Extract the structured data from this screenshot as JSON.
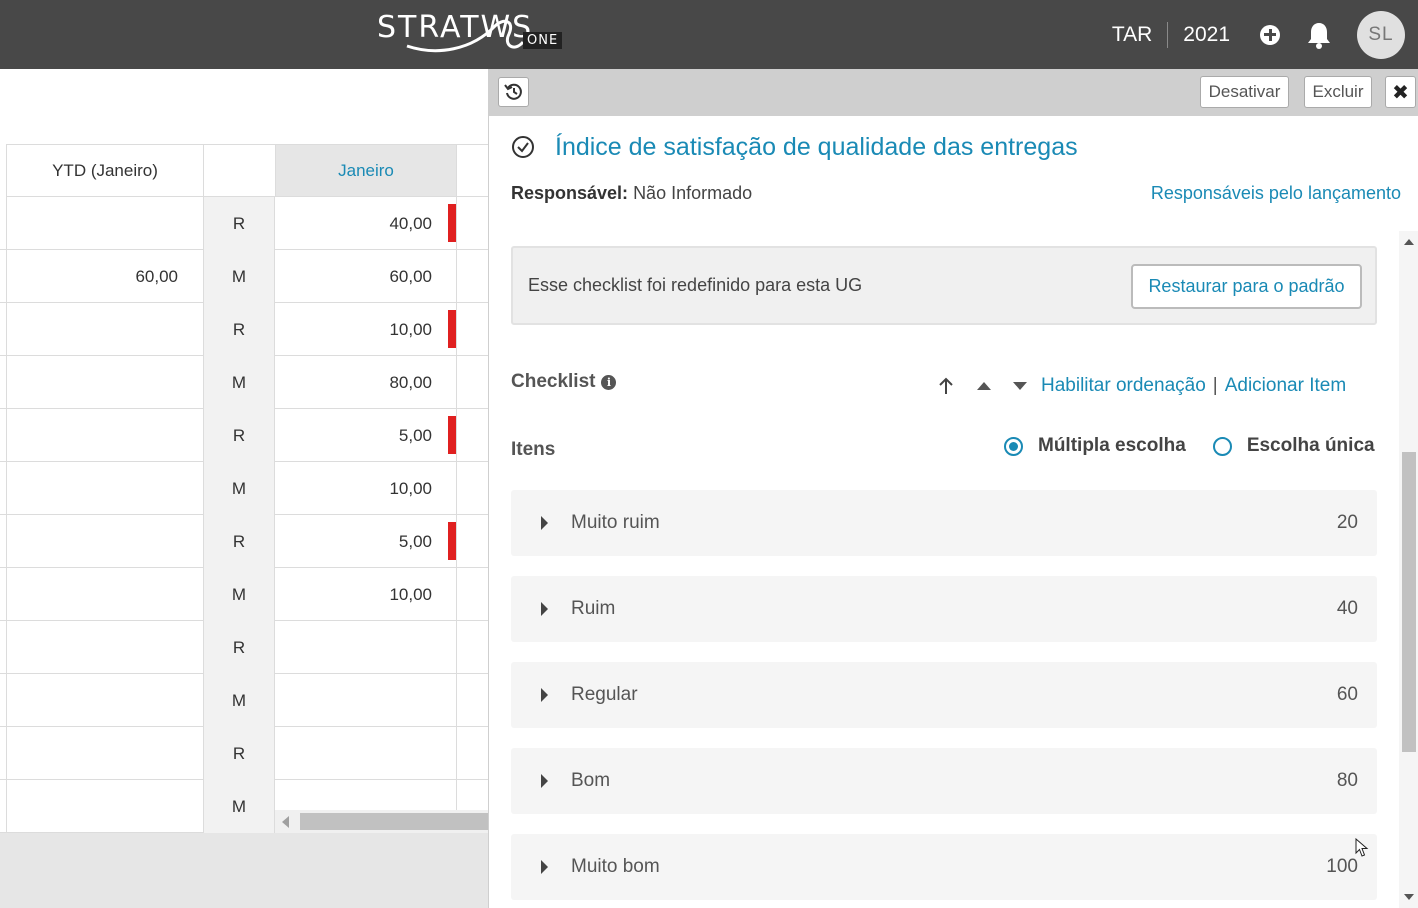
{
  "topbar": {
    "logo_text": "STRATWS",
    "logo_suffix": "ONE",
    "org": "TAR",
    "year": "2021",
    "avatar_initials": "SL",
    "icons": {
      "add": "plus-circle-icon",
      "notifications": "bell-icon"
    }
  },
  "table": {
    "headers": {
      "ytd": "YTD (Janeiro)",
      "type": "",
      "month": "Janeiro"
    },
    "rows": [
      {
        "ytd": "",
        "type": "R",
        "jan": "40,00",
        "flag": true
      },
      {
        "ytd": "60,00",
        "type": "M",
        "jan": "60,00",
        "flag": false
      },
      {
        "ytd": "",
        "type": "R",
        "jan": "10,00",
        "flag": true
      },
      {
        "ytd": "",
        "type": "M",
        "jan": "80,00",
        "flag": false
      },
      {
        "ytd": "",
        "type": "R",
        "jan": "5,00",
        "flag": true
      },
      {
        "ytd": "",
        "type": "M",
        "jan": "10,00",
        "flag": false
      },
      {
        "ytd": "",
        "type": "R",
        "jan": "5,00",
        "flag": true
      },
      {
        "ytd": "",
        "type": "M",
        "jan": "10,00",
        "flag": false
      },
      {
        "ytd": "",
        "type": "R",
        "jan": "",
        "flag": false
      },
      {
        "ytd": "",
        "type": "M",
        "jan": "",
        "flag": false
      },
      {
        "ytd": "",
        "type": "R",
        "jan": "",
        "flag": false
      },
      {
        "ytd": "",
        "type": "M",
        "jan": "",
        "flag": false
      }
    ]
  },
  "panel": {
    "toolbar": {
      "history_icon": "history-icon",
      "deactivate": "Desativar",
      "delete": "Excluir",
      "close": "✖"
    },
    "title": "Índice de satisfação de qualidade das entregas",
    "responsible_label": "Responsável:",
    "responsible_value": "Não Informado",
    "responsible_link": "Responsáveis pelo lançamento",
    "notice": {
      "text": "Esse checklist foi redefinido para esta UG",
      "button": "Restaurar para o padrão"
    },
    "checklist_label": "Checklist",
    "enable_sorting": "Habilitar ordenação",
    "add_item": "Adicionar Item",
    "items_label": "Itens",
    "choice": {
      "multiple": "Múltipla escolha",
      "single": "Escolha única",
      "selected": "multiple"
    },
    "items": [
      {
        "label": "Muito ruim",
        "score": "20"
      },
      {
        "label": "Ruim",
        "score": "40"
      },
      {
        "label": "Regular",
        "score": "60"
      },
      {
        "label": "Bom",
        "score": "80"
      },
      {
        "label": "Muito bom",
        "score": "100"
      }
    ]
  },
  "colors": {
    "accent": "#1a8ab5",
    "topbar": "#484848",
    "flag": "#e02020"
  }
}
